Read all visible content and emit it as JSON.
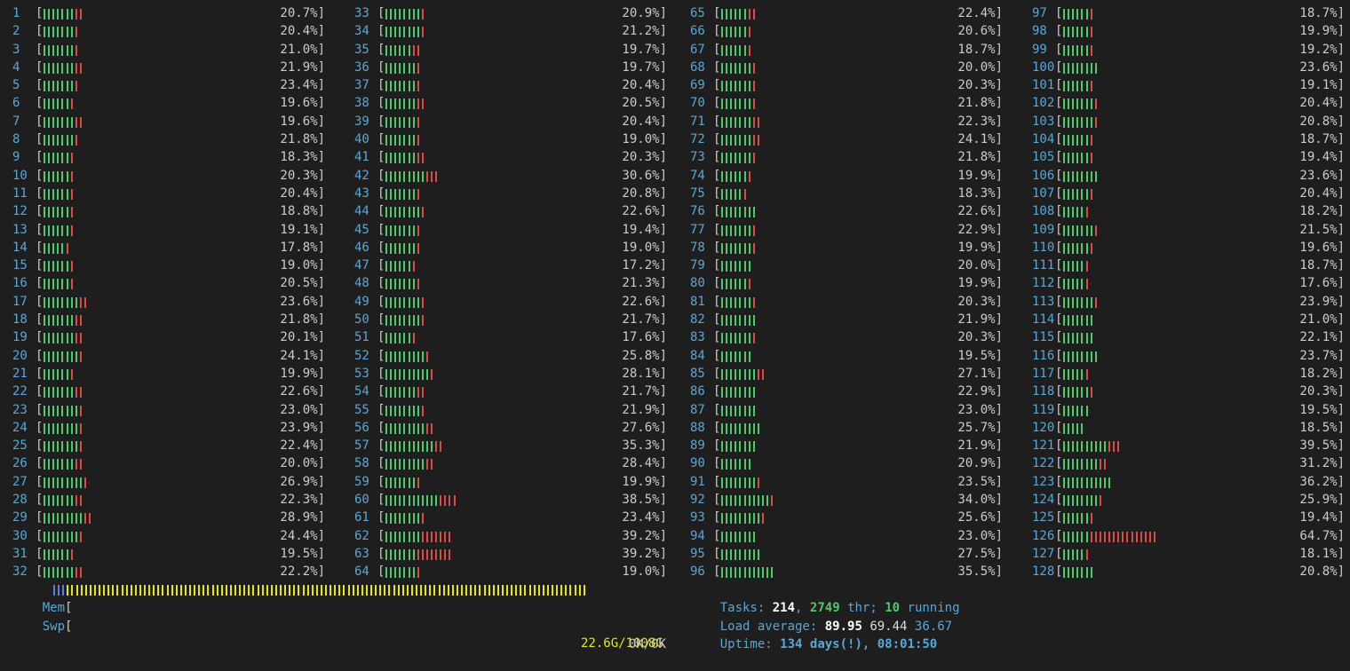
{
  "cpus": [
    {
      "n": "1",
      "pct": "20.7%",
      "g": 7,
      "r": 2
    },
    {
      "n": "2",
      "pct": "20.4%",
      "g": 7,
      "r": 1
    },
    {
      "n": "3",
      "pct": "21.0%",
      "g": 7,
      "r": 1
    },
    {
      "n": "4",
      "pct": "21.9%",
      "g": 7,
      "r": 2
    },
    {
      "n": "5",
      "pct": "23.4%",
      "g": 7,
      "r": 1
    },
    {
      "n": "6",
      "pct": "19.6%",
      "g": 6,
      "r": 1
    },
    {
      "n": "7",
      "pct": "19.6%",
      "g": 7,
      "r": 2
    },
    {
      "n": "8",
      "pct": "21.8%",
      "g": 7,
      "r": 1
    },
    {
      "n": "9",
      "pct": "18.3%",
      "g": 6,
      "r": 1
    },
    {
      "n": "10",
      "pct": "20.3%",
      "g": 6,
      "r": 1
    },
    {
      "n": "11",
      "pct": "20.4%",
      "g": 6,
      "r": 1
    },
    {
      "n": "12",
      "pct": "18.8%",
      "g": 6,
      "r": 1
    },
    {
      "n": "13",
      "pct": "19.1%",
      "g": 6,
      "r": 1
    },
    {
      "n": "14",
      "pct": "17.8%",
      "g": 5,
      "r": 1
    },
    {
      "n": "15",
      "pct": "19.0%",
      "g": 6,
      "r": 1
    },
    {
      "n": "16",
      "pct": "20.5%",
      "g": 6,
      "r": 1
    },
    {
      "n": "17",
      "pct": "23.6%",
      "g": 8,
      "r": 2
    },
    {
      "n": "18",
      "pct": "21.8%",
      "g": 7,
      "r": 2
    },
    {
      "n": "19",
      "pct": "20.1%",
      "g": 7,
      "r": 2
    },
    {
      "n": "20",
      "pct": "24.1%",
      "g": 8,
      "r": 1
    },
    {
      "n": "21",
      "pct": "19.9%",
      "g": 6,
      "r": 1
    },
    {
      "n": "22",
      "pct": "22.6%",
      "g": 7,
      "r": 2
    },
    {
      "n": "23",
      "pct": "23.0%",
      "g": 8,
      "r": 1
    },
    {
      "n": "24",
      "pct": "23.9%",
      "g": 8,
      "r": 1
    },
    {
      "n": "25",
      "pct": "22.4%",
      "g": 8,
      "r": 1
    },
    {
      "n": "26",
      "pct": "20.0%",
      "g": 7,
      "r": 2
    },
    {
      "n": "27",
      "pct": "26.9%",
      "g": 9,
      "r": 1
    },
    {
      "n": "28",
      "pct": "22.3%",
      "g": 7,
      "r": 2
    },
    {
      "n": "29",
      "pct": "28.9%",
      "g": 9,
      "r": 2
    },
    {
      "n": "30",
      "pct": "24.4%",
      "g": 8,
      "r": 1
    },
    {
      "n": "31",
      "pct": "19.5%",
      "g": 6,
      "r": 1
    },
    {
      "n": "32",
      "pct": "22.2%",
      "g": 7,
      "r": 2
    },
    {
      "n": "33",
      "pct": "20.9%",
      "g": 8,
      "r": 1
    },
    {
      "n": "34",
      "pct": "21.2%",
      "g": 8,
      "r": 1
    },
    {
      "n": "35",
      "pct": "19.7%",
      "g": 6,
      "r": 2
    },
    {
      "n": "36",
      "pct": "19.7%",
      "g": 7,
      "r": 1
    },
    {
      "n": "37",
      "pct": "20.4%",
      "g": 7,
      "r": 1
    },
    {
      "n": "38",
      "pct": "20.5%",
      "g": 7,
      "r": 2
    },
    {
      "n": "39",
      "pct": "20.4%",
      "g": 7,
      "r": 1
    },
    {
      "n": "40",
      "pct": "19.0%",
      "g": 7,
      "r": 1
    },
    {
      "n": "41",
      "pct": "20.3%",
      "g": 7,
      "r": 2
    },
    {
      "n": "42",
      "pct": "30.6%",
      "g": 9,
      "r": 3
    },
    {
      "n": "43",
      "pct": "20.8%",
      "g": 7,
      "r": 1
    },
    {
      "n": "44",
      "pct": "22.6%",
      "g": 8,
      "r": 1
    },
    {
      "n": "45",
      "pct": "19.4%",
      "g": 7,
      "r": 1
    },
    {
      "n": "46",
      "pct": "19.0%",
      "g": 7,
      "r": 1
    },
    {
      "n": "47",
      "pct": "17.2%",
      "g": 6,
      "r": 1
    },
    {
      "n": "48",
      "pct": "21.3%",
      "g": 7,
      "r": 1
    },
    {
      "n": "49",
      "pct": "22.6%",
      "g": 8,
      "r": 1
    },
    {
      "n": "50",
      "pct": "21.7%",
      "g": 8,
      "r": 1
    },
    {
      "n": "51",
      "pct": "17.6%",
      "g": 6,
      "r": 1
    },
    {
      "n": "52",
      "pct": "25.8%",
      "g": 9,
      "r": 1
    },
    {
      "n": "53",
      "pct": "28.1%",
      "g": 10,
      "r": 1
    },
    {
      "n": "54",
      "pct": "21.7%",
      "g": 7,
      "r": 2
    },
    {
      "n": "55",
      "pct": "21.9%",
      "g": 8,
      "r": 1
    },
    {
      "n": "56",
      "pct": "27.6%",
      "g": 9,
      "r": 2
    },
    {
      "n": "57",
      "pct": "35.3%",
      "g": 11,
      "r": 2
    },
    {
      "n": "58",
      "pct": "28.4%",
      "g": 9,
      "r": 2
    },
    {
      "n": "59",
      "pct": "19.9%",
      "g": 7,
      "r": 1
    },
    {
      "n": "60",
      "pct": "38.5%",
      "g": 12,
      "r": 4
    },
    {
      "n": "61",
      "pct": "23.4%",
      "g": 8,
      "r": 1
    },
    {
      "n": "62",
      "pct": "39.2%",
      "g": 8,
      "r": 7
    },
    {
      "n": "63",
      "pct": "39.2%",
      "g": 7,
      "r": 8
    },
    {
      "n": "64",
      "pct": "19.0%",
      "g": 7,
      "r": 1
    },
    {
      "n": "65",
      "pct": "22.4%",
      "g": 6,
      "r": 2
    },
    {
      "n": "66",
      "pct": "20.6%",
      "g": 6,
      "r": 1
    },
    {
      "n": "67",
      "pct": "18.7%",
      "g": 6,
      "r": 1
    },
    {
      "n": "68",
      "pct": "20.0%",
      "g": 7,
      "r": 1
    },
    {
      "n": "69",
      "pct": "20.3%",
      "g": 7,
      "r": 1
    },
    {
      "n": "70",
      "pct": "21.8%",
      "g": 7,
      "r": 1
    },
    {
      "n": "71",
      "pct": "22.3%",
      "g": 7,
      "r": 2
    },
    {
      "n": "72",
      "pct": "24.1%",
      "g": 7,
      "r": 2
    },
    {
      "n": "73",
      "pct": "21.8%",
      "g": 7,
      "r": 1
    },
    {
      "n": "74",
      "pct": "19.9%",
      "g": 6,
      "r": 1
    },
    {
      "n": "75",
      "pct": "18.3%",
      "g": 5,
      "r": 1
    },
    {
      "n": "76",
      "pct": "22.6%",
      "g": 8,
      "r": 0
    },
    {
      "n": "77",
      "pct": "22.9%",
      "g": 7,
      "r": 1
    },
    {
      "n": "78",
      "pct": "19.9%",
      "g": 7,
      "r": 1
    },
    {
      "n": "79",
      "pct": "20.0%",
      "g": 7,
      "r": 0
    },
    {
      "n": "80",
      "pct": "19.9%",
      "g": 6,
      "r": 1
    },
    {
      "n": "81",
      "pct": "20.3%",
      "g": 7,
      "r": 1
    },
    {
      "n": "82",
      "pct": "21.9%",
      "g": 8,
      "r": 0
    },
    {
      "n": "83",
      "pct": "20.3%",
      "g": 7,
      "r": 1
    },
    {
      "n": "84",
      "pct": "19.5%",
      "g": 7,
      "r": 0
    },
    {
      "n": "85",
      "pct": "27.1%",
      "g": 8,
      "r": 2
    },
    {
      "n": "86",
      "pct": "22.9%",
      "g": 8,
      "r": 0
    },
    {
      "n": "87",
      "pct": "23.0%",
      "g": 8,
      "r": 0
    },
    {
      "n": "88",
      "pct": "25.7%",
      "g": 9,
      "r": 0
    },
    {
      "n": "89",
      "pct": "21.9%",
      "g": 8,
      "r": 0
    },
    {
      "n": "90",
      "pct": "20.9%",
      "g": 7,
      "r": 0
    },
    {
      "n": "91",
      "pct": "23.5%",
      "g": 8,
      "r": 1
    },
    {
      "n": "92",
      "pct": "34.0%",
      "g": 11,
      "r": 1
    },
    {
      "n": "93",
      "pct": "25.6%",
      "g": 9,
      "r": 1
    },
    {
      "n": "94",
      "pct": "23.0%",
      "g": 8,
      "r": 0
    },
    {
      "n": "95",
      "pct": "27.5%",
      "g": 9,
      "r": 0
    },
    {
      "n": "96",
      "pct": "35.5%",
      "g": 12,
      "r": 0
    },
    {
      "n": "97",
      "pct": "18.7%",
      "g": 6,
      "r": 1
    },
    {
      "n": "98",
      "pct": "19.9%",
      "g": 6,
      "r": 1
    },
    {
      "n": "99",
      "pct": "19.2%",
      "g": 6,
      "r": 1
    },
    {
      "n": "100",
      "pct": "23.6%",
      "g": 8,
      "r": 0
    },
    {
      "n": "101",
      "pct": "19.1%",
      "g": 6,
      "r": 1
    },
    {
      "n": "102",
      "pct": "20.4%",
      "g": 7,
      "r": 1
    },
    {
      "n": "103",
      "pct": "20.8%",
      "g": 7,
      "r": 1
    },
    {
      "n": "104",
      "pct": "18.7%",
      "g": 6,
      "r": 1
    },
    {
      "n": "105",
      "pct": "19.4%",
      "g": 6,
      "r": 1
    },
    {
      "n": "106",
      "pct": "23.6%",
      "g": 8,
      "r": 0
    },
    {
      "n": "107",
      "pct": "20.4%",
      "g": 6,
      "r": 1
    },
    {
      "n": "108",
      "pct": "18.2%",
      "g": 5,
      "r": 1
    },
    {
      "n": "109",
      "pct": "21.5%",
      "g": 7,
      "r": 1
    },
    {
      "n": "110",
      "pct": "19.6%",
      "g": 6,
      "r": 1
    },
    {
      "n": "111",
      "pct": "18.7%",
      "g": 5,
      "r": 1
    },
    {
      "n": "112",
      "pct": "17.6%",
      "g": 5,
      "r": 1
    },
    {
      "n": "113",
      "pct": "23.9%",
      "g": 7,
      "r": 1
    },
    {
      "n": "114",
      "pct": "21.0%",
      "g": 7,
      "r": 0
    },
    {
      "n": "115",
      "pct": "22.1%",
      "g": 7,
      "r": 0
    },
    {
      "n": "116",
      "pct": "23.7%",
      "g": 8,
      "r": 0
    },
    {
      "n": "117",
      "pct": "18.2%",
      "g": 5,
      "r": 1
    },
    {
      "n": "118",
      "pct": "20.3%",
      "g": 6,
      "r": 1
    },
    {
      "n": "119",
      "pct": "19.5%",
      "g": 6,
      "r": 0
    },
    {
      "n": "120",
      "pct": "18.5%",
      "g": 5,
      "r": 0
    },
    {
      "n": "121",
      "pct": "39.5%",
      "g": 10,
      "r": 3
    },
    {
      "n": "122",
      "pct": "31.2%",
      "g": 8,
      "r": 2
    },
    {
      "n": "123",
      "pct": "36.2%",
      "g": 11,
      "r": 0
    },
    {
      "n": "124",
      "pct": "25.9%",
      "g": 8,
      "r": 1
    },
    {
      "n": "125",
      "pct": "19.4%",
      "g": 6,
      "r": 1
    },
    {
      "n": "126",
      "pct": "64.7%",
      "g": 6,
      "r": 15
    },
    {
      "n": "127",
      "pct": "18.1%",
      "g": 5,
      "r": 1
    },
    {
      "n": "128",
      "pct": "20.8%",
      "g": 7,
      "r": 0
    }
  ],
  "mem": {
    "label": "Mem",
    "bracket_open": "[",
    "value": "22.6G/1008G",
    "level_fraction": 0.0224
  },
  "swp": {
    "label": "Swp",
    "bracket_open": "[",
    "value": "0K/0K"
  },
  "tasks": {
    "label": "Tasks:",
    "count": "214",
    "sep1": ",",
    "threads": "2749",
    "thr_label": "thr;",
    "running": "10",
    "running_label": "running"
  },
  "load": {
    "label": "Load average:",
    "v1": "89.95",
    "v2": "69.44",
    "v3": "36.67"
  },
  "uptime": {
    "label": "Uptime:",
    "value": "134 days(!), 08:01:50"
  },
  "colors": {
    "bg": "#1e1e1e",
    "cpu_num": "#5aa7d6",
    "bar_green": "#4ec96a",
    "bar_red": "#d94a4a",
    "bar_yellow": "#e5e510",
    "text": "#cccccc"
  }
}
